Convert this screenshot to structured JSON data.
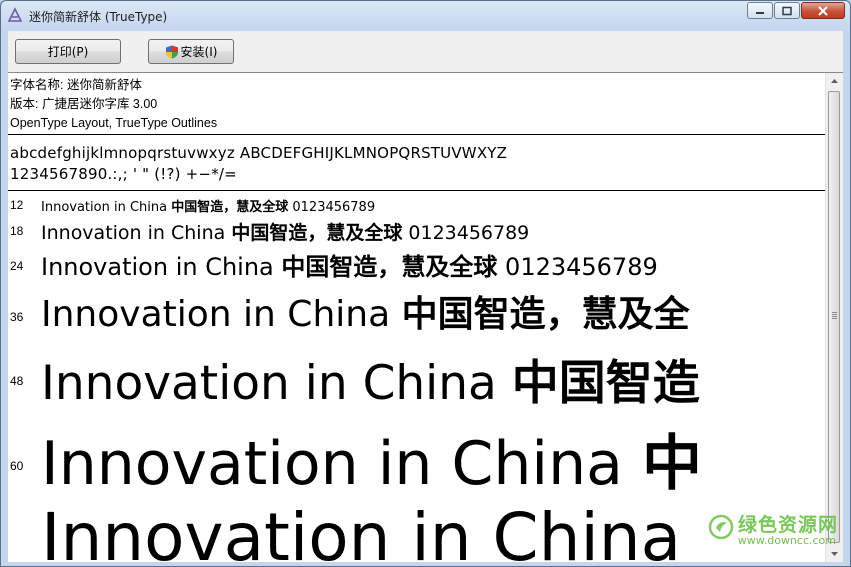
{
  "window": {
    "title": "迷你简新舒体 (TrueType)"
  },
  "toolbar": {
    "print_label": "打印(P)",
    "install_label": "安装(I)"
  },
  "info": {
    "font_name": "字体名称: 迷你简新舒体",
    "version": "版本: 广捷居迷你字库 3.00",
    "outlines": "OpenType Layout, TrueType Outlines"
  },
  "charset": {
    "letters": "abcdefghijklmnopqrstuvwxyz ABCDEFGHIJKLMNOPQRSTUVWXYZ",
    "digits": "1234567890.:,; ' \" (!?) +−*/="
  },
  "samples": [
    {
      "size": "12",
      "latin": "Innovation in China",
      "cjk": "中国智造，慧及全球",
      "digits": "0123456789"
    },
    {
      "size": "18",
      "latin": "Innovation in China",
      "cjk": "中国智造，慧及全球",
      "digits": "0123456789"
    },
    {
      "size": "24",
      "latin": "Innovation in China",
      "cjk": "中国智造，慧及全球",
      "digits": "0123456789"
    },
    {
      "size": "36",
      "latin": "Innovation in China",
      "cjk": "中国智造，慧及全",
      "digits": ""
    },
    {
      "size": "48",
      "latin": "Innovation in China",
      "cjk": "中国智造",
      "digits": ""
    },
    {
      "size": "60",
      "latin": "Innovation in China",
      "cjk": "中",
      "digits": ""
    },
    {
      "size": "",
      "latin": "Innovation in China",
      "cjk": "",
      "digits": ""
    }
  ],
  "watermark": {
    "main": "绿色资源网",
    "sub": "www.downcc.com"
  },
  "colors": {
    "watermark_green": "#6cc14a",
    "close_button_red": "#c7523a"
  }
}
